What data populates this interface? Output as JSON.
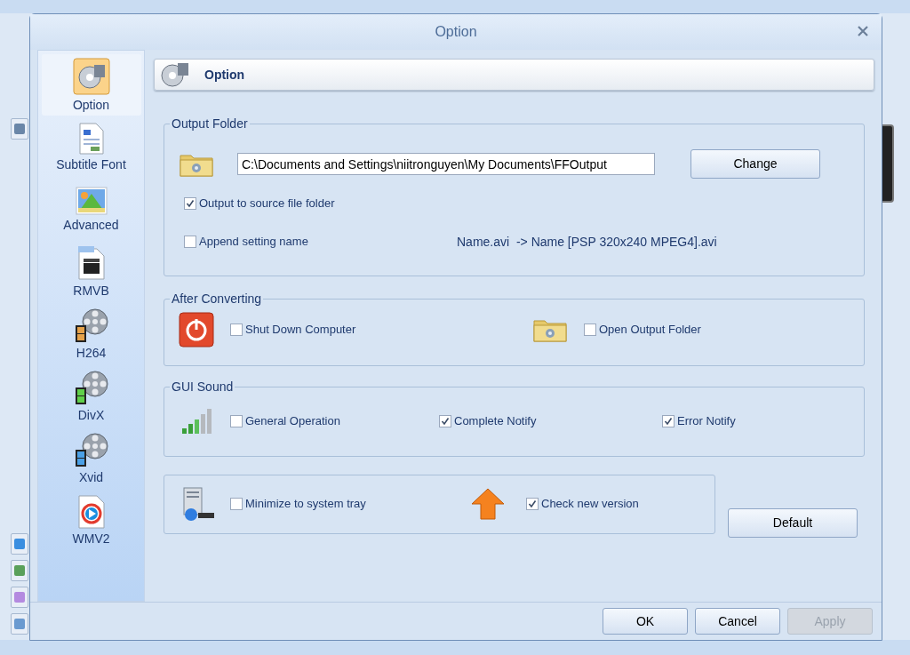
{
  "window": {
    "title": "Option"
  },
  "sidebar": {
    "items": [
      {
        "label": "Option",
        "selected": true
      },
      {
        "label": "Subtitle Font",
        "selected": false
      },
      {
        "label": "Advanced",
        "selected": false
      },
      {
        "label": "RMVB",
        "selected": false
      },
      {
        "label": "H264",
        "selected": false
      },
      {
        "label": "DivX",
        "selected": false
      },
      {
        "label": "Xvid",
        "selected": false
      },
      {
        "label": "WMV2",
        "selected": false
      }
    ]
  },
  "header": {
    "title": "Option"
  },
  "output_folder": {
    "title": "Output Folder",
    "path": "C:\\Documents and Settings\\niitronguyen\\My Documents\\FFOutput",
    "change_button": "Change",
    "options": [
      {
        "label": "Output to source file folder",
        "checked": true
      },
      {
        "label": "Append setting name",
        "checked": false
      }
    ],
    "example": "Name.avi  -> Name [PSP 320x240 MPEG4].avi"
  },
  "after_converting": {
    "title": "After Converting",
    "options": [
      {
        "label": "Shut Down Computer",
        "checked": false
      },
      {
        "label": "Open Output Folder",
        "checked": false
      }
    ]
  },
  "gui_sound": {
    "title": "GUI Sound",
    "options": [
      {
        "label": "General Operation",
        "checked": false
      },
      {
        "label": "Complete Notify",
        "checked": true
      },
      {
        "label": "Error Notify",
        "checked": true
      }
    ]
  },
  "misc": {
    "options": [
      {
        "label": "Minimize to system tray",
        "checked": false
      },
      {
        "label": "Check new version",
        "checked": true
      }
    ]
  },
  "default_button": {
    "label": "Default",
    "disabled": false
  },
  "footer_buttons": [
    {
      "label": "OK",
      "disabled": false
    },
    {
      "label": "Cancel",
      "disabled": false
    },
    {
      "label": "Apply",
      "disabled": true
    }
  ]
}
